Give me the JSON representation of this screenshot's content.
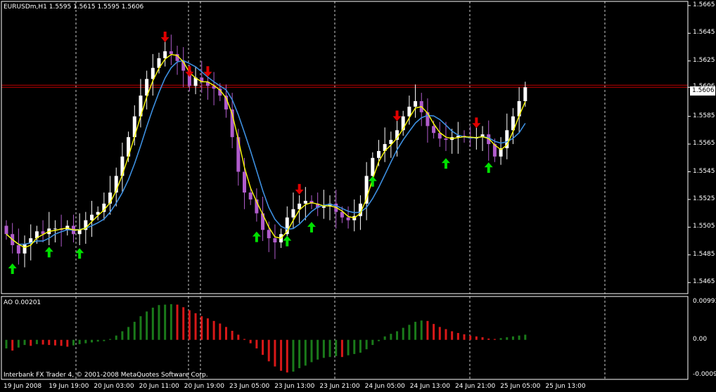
{
  "header": {
    "symbol_text": "EURUSDm,H1 1.5595 1.5615 1.5595 1.5606"
  },
  "footer": {
    "copyright": "Interbank FX Trader 4, © 2001-2008 MetaQuotes Software Corp."
  },
  "indicator": {
    "label": "AO 0.00201"
  },
  "colors": {
    "background": "#000000",
    "frame": "#ffffff",
    "bull_candle": "#ffffff",
    "bear_candle": "#b05ccc",
    "fast_ma": "#ffff00",
    "slow_ma": "#3d8fe0",
    "up_arrow": "#00e000",
    "down_arrow": "#e00000",
    "ao_up": "#1a7a1a",
    "ao_down": "#d81818",
    "current_price_line": "#c00000",
    "grid": "#ffffff"
  },
  "chart_data": [
    {
      "type": "candlestick",
      "title": "EURUSDm,H1 1.5595 1.5615 1.5595 1.5606",
      "ylim": [
        1.5457,
        1.5668
      ],
      "price_ticks": [
        "1.5665",
        "1.5645",
        "1.5625",
        "1.5606",
        "1.5585",
        "1.5565",
        "1.5545",
        "1.5525",
        "1.5505",
        "1.5485",
        "1.5465"
      ],
      "current_price": "1.5606",
      "time_labels": [
        "19 Jun 2008",
        "19 Jun 19:00",
        "20 Jun 03:00",
        "20 Jun 11:00",
        "20 Jun 19:00",
        "23 Jun 05:00",
        "23 Jun 13:00",
        "23 Jun 21:00",
        "24 Jun 05:00",
        "24 Jun 13:00",
        "24 Jun 21:00",
        "25 Jun 05:00",
        "25 Jun 13:00"
      ],
      "close_path": [
        1.55,
        1.5492,
        1.5486,
        1.5493,
        1.5497,
        1.5502,
        1.55,
        1.5504,
        1.5504,
        1.5503,
        1.5506,
        1.55,
        1.5503,
        1.551,
        1.5514,
        1.5516,
        1.5522,
        1.553,
        1.5542,
        1.5556,
        1.557,
        1.5585,
        1.56,
        1.5612,
        1.562,
        1.5627,
        1.5632,
        1.563,
        1.5625,
        1.5618,
        1.5607,
        1.5613,
        1.561,
        1.5607,
        1.5605,
        1.56,
        1.559,
        1.557,
        1.5545,
        1.553,
        1.5525,
        1.5515,
        1.5503,
        1.5497,
        1.5494,
        1.55,
        1.5512,
        1.5518,
        1.5522,
        1.5524,
        1.5522,
        1.5519,
        1.552,
        1.5522,
        1.5516,
        1.5512,
        1.551,
        1.5513,
        1.5522,
        1.5542,
        1.5555,
        1.556,
        1.5565,
        1.5568,
        1.5575,
        1.5585,
        1.5592,
        1.5596,
        1.5588,
        1.5578,
        1.5573,
        1.5569,
        1.5568,
        1.557,
        1.5571,
        1.557,
        1.5569,
        1.557,
        1.5572,
        1.5565,
        1.5556,
        1.5562,
        1.5575,
        1.5585,
        1.5596,
        1.5606
      ],
      "ao_ylim": [
        -0.00092,
        0.00101
      ],
      "ao_ticks": [
        "0.00993",
        "0.00",
        "-0.00092"
      ],
      "ao_values": [
        -0.0002,
        -0.00025,
        -0.00018,
        -0.00012,
        -0.00014,
        -0.0001,
        -0.00011,
        -0.00012,
        -0.00013,
        -0.00014,
        -0.00016,
        -0.00013,
        -0.0001,
        -8e-05,
        -6e-05,
        -4e-05,
        -3e-05,
        2e-05,
        0.0001,
        0.0002,
        0.0003,
        0.00042,
        0.00055,
        0.00066,
        0.00075,
        0.00081,
        0.00082,
        0.00083,
        0.00082,
        0.00076,
        0.00069,
        0.00062,
        0.00055,
        0.0005,
        0.00044,
        0.00038,
        0.0003,
        0.00021,
        0.00012,
        2e-05,
        -8e-05,
        -0.0002,
        -0.00035,
        -0.0005,
        -0.00062,
        -0.00072,
        -0.00076,
        -0.00074,
        -0.00066,
        -0.0006,
        -0.00052,
        -0.00046,
        -0.00042,
        -0.0004,
        -0.00038,
        -0.0004,
        -0.00036,
        -0.00033,
        -0.0003,
        -0.00022,
        -0.00012,
        -3e-05,
        8e-05,
        0.00014,
        0.0002,
        0.00028,
        0.00035,
        0.00042,
        0.00045,
        0.00044,
        0.00037,
        0.0003,
        0.00025,
        0.0002,
        0.00016,
        0.00013,
        0.0001,
        8e-05,
        6e-05,
        3e-05,
        2e-05,
        4e-05,
        6e-05,
        8e-05,
        0.0001,
        0.00012
      ],
      "up_arrow_bars": [
        1,
        7,
        12,
        41,
        46,
        50,
        60,
        72,
        79
      ],
      "down_arrow_bars": [
        26,
        30,
        33,
        48,
        64,
        77
      ]
    }
  ]
}
